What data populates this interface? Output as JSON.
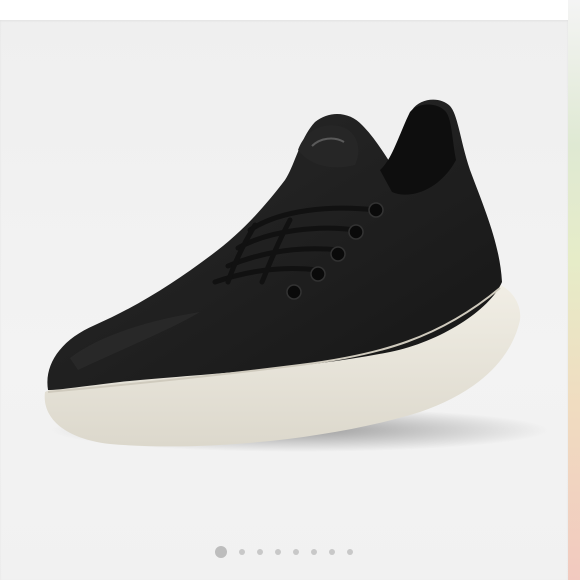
{
  "product": {
    "image_icon": "wool-runner-sneaker",
    "upper_color": "#1c1c1c",
    "sole_color": "#ece9df"
  },
  "carousel": {
    "slide_count": 8,
    "active_index": 0
  }
}
